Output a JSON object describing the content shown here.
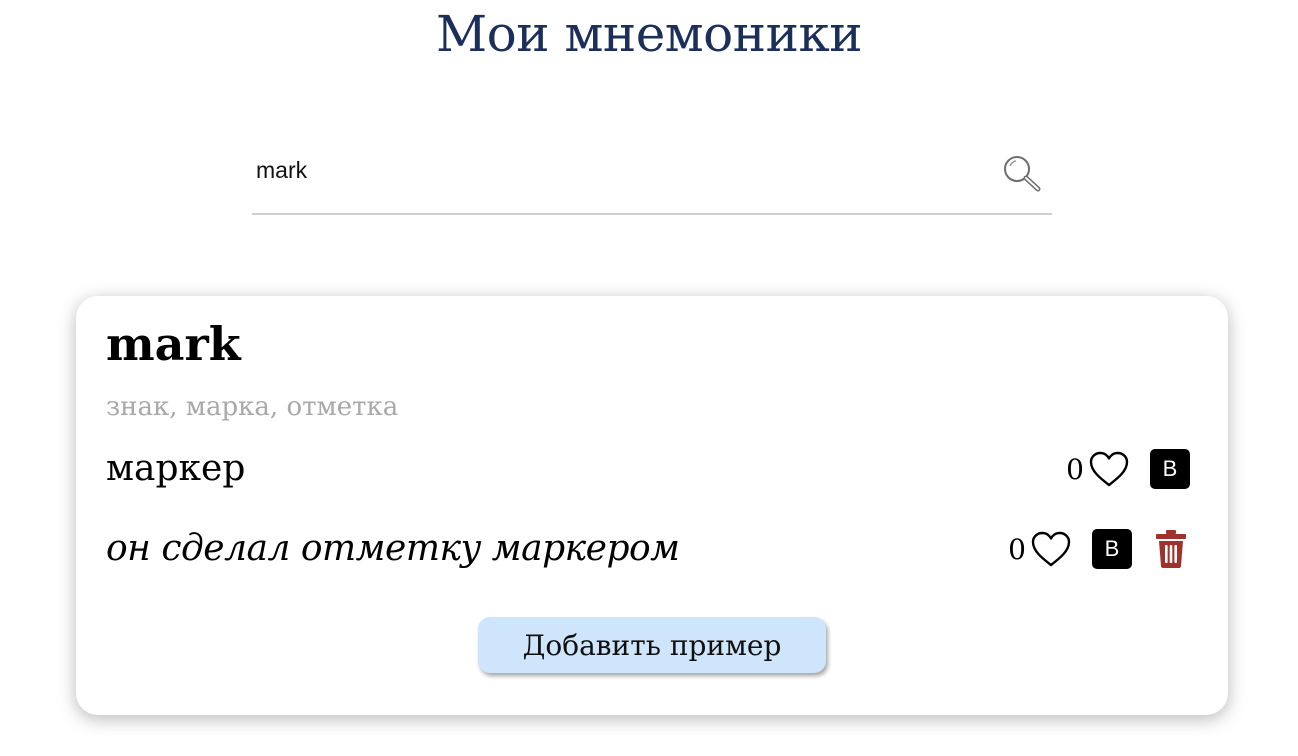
{
  "page": {
    "title": "Мои мнемоники"
  },
  "search": {
    "value": "mark",
    "icon": "search-icon"
  },
  "card": {
    "word": "mark",
    "translation": "знак, марка, отметка",
    "mnemonics": [
      {
        "text": "маркер",
        "likes": "0",
        "b_label": "B",
        "deletable": false
      },
      {
        "text": "он сделал отметку маркером",
        "likes": "0",
        "b_label": "B",
        "deletable": true
      }
    ],
    "add_example_label": "Добавить пример"
  },
  "colors": {
    "title": "#1b2f5a",
    "translation": "#a9a9a9",
    "add_button_bg": "#cfe5fb",
    "trash": "#a0322d"
  }
}
